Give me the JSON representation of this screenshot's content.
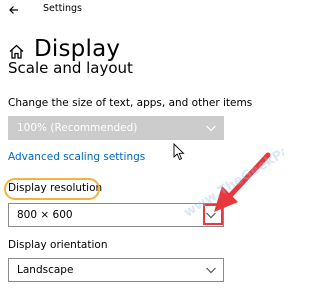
{
  "window": {
    "app_title": "Settings",
    "back_icon": "back-arrow-icon"
  },
  "header": {
    "home_icon": "home-icon",
    "title": "Display"
  },
  "scale_layout": {
    "section_title": "Scale and layout",
    "size_label": "Change the size of text, apps, and other items",
    "size_value": "100% (Recommended)",
    "size_disabled": true,
    "advanced_link": "Advanced scaling settings"
  },
  "resolution": {
    "label": "Display resolution",
    "value": "800 × 600"
  },
  "orientation": {
    "label": "Display orientation",
    "value": "Landscape"
  },
  "watermark": {
    "text": "www.TheGeekPage.com"
  },
  "colors": {
    "link": "#0067c0",
    "annotation_orange": "#f2b43c",
    "annotation_red": "#e8383f",
    "disabled_dropdown": "#cccccc"
  }
}
